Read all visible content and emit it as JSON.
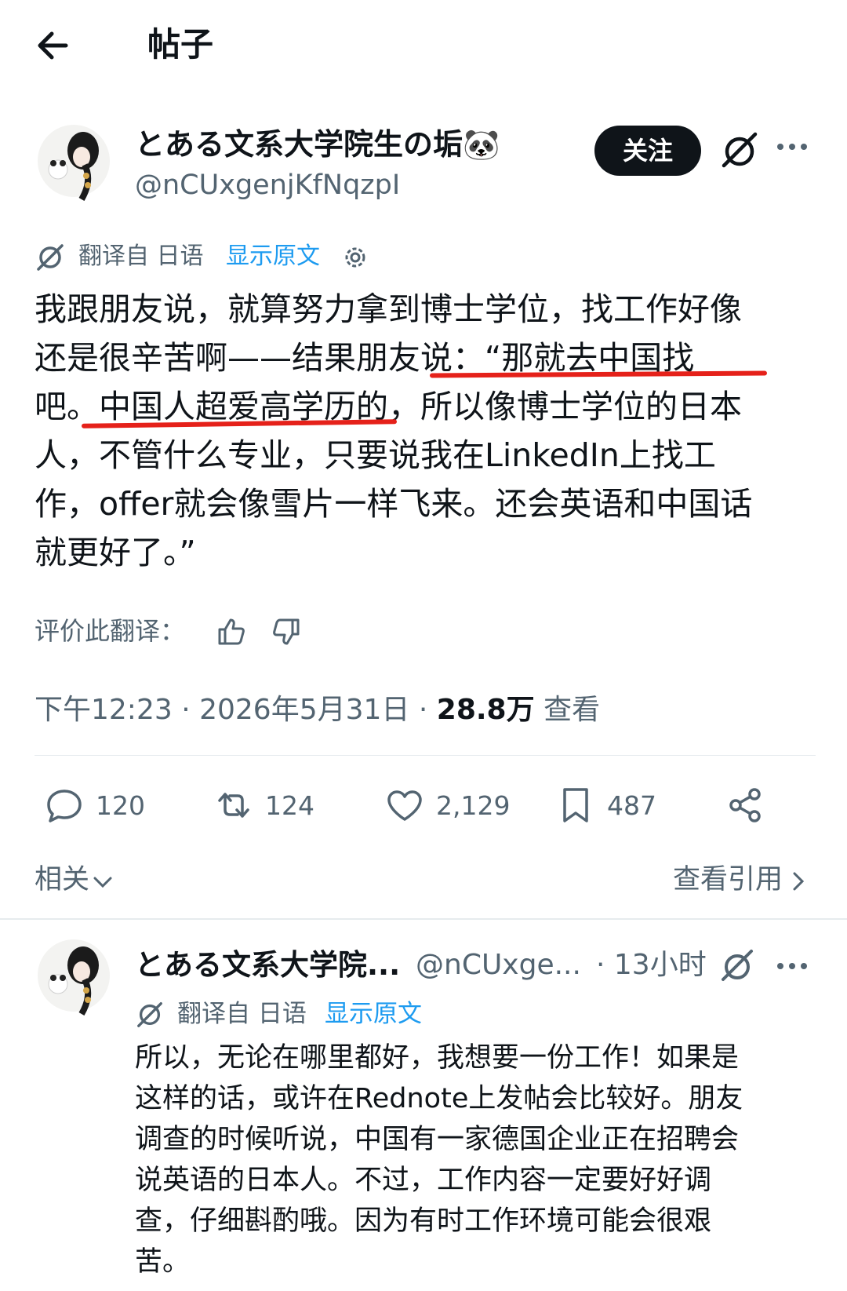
{
  "header": {
    "title": "帖子"
  },
  "post": {
    "author_name": "とある文系大学院生の垢🐼",
    "author_handle": "@nCUxgenjKfNqzpI",
    "follow_label": "关注",
    "translated_from": "翻译自 日语",
    "show_original": "显示原文",
    "body_lines": [
      "我跟朋友说，就算努力拿到博士学位，找工作好像",
      "还是很辛苦啊——结果朋友说：“那就去中国找",
      "吧。中国人超爱高学历的，所以像博士学位的日本",
      "人，不管什么专业，只要说我在LinkedIn上找工",
      "作，offer就会像雪片一样飞来。还会英语和中国话",
      "就更好了。”"
    ],
    "rate_translation": "评价此翻译：",
    "time": "下午12:23",
    "date": "2026年5月31日",
    "views_count": "28.8万",
    "views_label": "查看",
    "replies": "120",
    "reposts": "124",
    "likes": "2,129",
    "bookmarks": "487",
    "related_label": "相关",
    "view_quotes_label": "查看引用"
  },
  "reply": {
    "author_name": "とある文系大学院...",
    "author_handle": "@nCUxge...",
    "time": "· 13小时",
    "translated_from": "翻译自 日语",
    "show_original": "显示原文",
    "body_lines": [
      "所以，无论在哪里都好，我想要一份工作！如果是",
      "这样的话，或许在Rednote上发帖会比较好。朋友",
      "调查的时候听说，中国有一家德国企业正在招聘会",
      "说英语的日本人。不过，工作内容一定要好好调",
      "查，仔细斟酌哦。因为有时工作环境可能会很艰",
      "苦。"
    ]
  },
  "colors": {
    "link": "#1d9bf0",
    "muted": "#536471",
    "text": "#0f1419",
    "annotation": "#e5211a"
  },
  "icons": [
    "back-arrow-icon",
    "grok-icon",
    "more-icon",
    "translate-icon",
    "settings-icon",
    "thumbs-up-icon",
    "thumbs-down-icon",
    "reply-icon",
    "repost-icon",
    "like-icon",
    "bookmark-icon",
    "share-icon",
    "chevron-down-icon",
    "chevron-right-icon"
  ]
}
